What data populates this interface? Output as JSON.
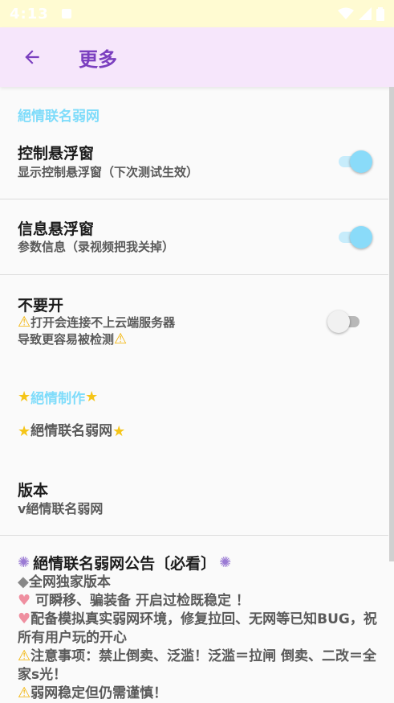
{
  "status_bar": {
    "time": "4:13"
  },
  "app_bar": {
    "title": "更多"
  },
  "section_group": {
    "label": "絕情联名弱网"
  },
  "pref_float": {
    "title": "控制悬浮窗",
    "summary": "显示控制悬浮窗（下次测试生效）",
    "enabled": true
  },
  "pref_info": {
    "title": "信息悬浮窗",
    "summary": "参数信息（录视频把我关掉）",
    "enabled": true
  },
  "pref_danger": {
    "title": "不要开",
    "summary_line1": "打开会连接不上云端服务器",
    "summary_line2": "导致更容易被检测",
    "enabled": false
  },
  "section_made": {
    "label": "絕情制作"
  },
  "brand_line": {
    "text": "絕情联名弱网"
  },
  "version": {
    "title": "版本",
    "value": "v絕情联名弱网"
  },
  "notice": {
    "title": "絕情联名弱网公告〔必看〕",
    "line1": "全网独家版本",
    "line2": " 可瞬移、骗装备 开启过检既稳定 ！",
    "line3": "配备模拟真实弱网环境，修复拉回、无网等已知BUG，祝所有用户玩的开心",
    "line4": "注意事项：禁止倒卖、泛滥！泛滥＝拉闸 倒卖、二改＝全家s光！",
    "line5": "弱网稳定但仍需谨慎！"
  },
  "colors": {
    "status_bar_bg": "#fffbd2",
    "app_bar_bg": "#f6e6fb",
    "title_purple": "#7b3fbf",
    "category_blue": "#7fdcfa",
    "switch_on": "#8adbf9"
  }
}
